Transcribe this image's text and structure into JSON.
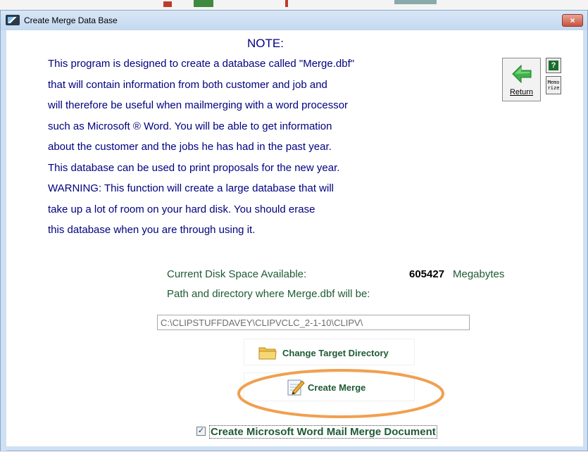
{
  "window": {
    "title": "Create Merge Data Base",
    "close_glyph": "×"
  },
  "note": {
    "heading": "NOTE:",
    "lines": [
      "This program is designed to create a database called \"Merge.dbf\"",
      "that will contain information from both customer and job and",
      "will therefore be useful when mailmerging with a word processor",
      "such as Microsoft ® Word.  You will be able to get information",
      "about the customer and the jobs he has had in the past year.",
      "This database can be used to print proposals for the new year.",
      "WARNING: This function will create a large database that will",
      "take up a lot of room on your hard disk.  You should erase",
      "this database when you are through using it."
    ]
  },
  "toolbar": {
    "return_label": "Return",
    "help_glyph": "?",
    "memorize_label": "Memo rize",
    "icons": [
      "return-arrow-icon",
      "help-icon",
      "memorize-icon"
    ]
  },
  "disk": {
    "label": "Current Disk Space Available:",
    "value": "605427",
    "unit": "Megabytes"
  },
  "path": {
    "label": "Path and directory where Merge.dbf will be:",
    "value": "C:\\CLIPSTUFFDAVEY\\CLIPVCLC_2-1-10\\CLIPV\\"
  },
  "buttons": {
    "change_target": "Change Target Directory",
    "create_merge": "Create Merge"
  },
  "checkbox": {
    "label": "Create Microsoft Word Mail Merge Document",
    "checked": true,
    "glyph": "✓"
  },
  "colors": {
    "note_text": "#000080",
    "label_green": "#1f5a35",
    "highlight_ring": "#f0a050",
    "frame": "#cfe0f3"
  }
}
